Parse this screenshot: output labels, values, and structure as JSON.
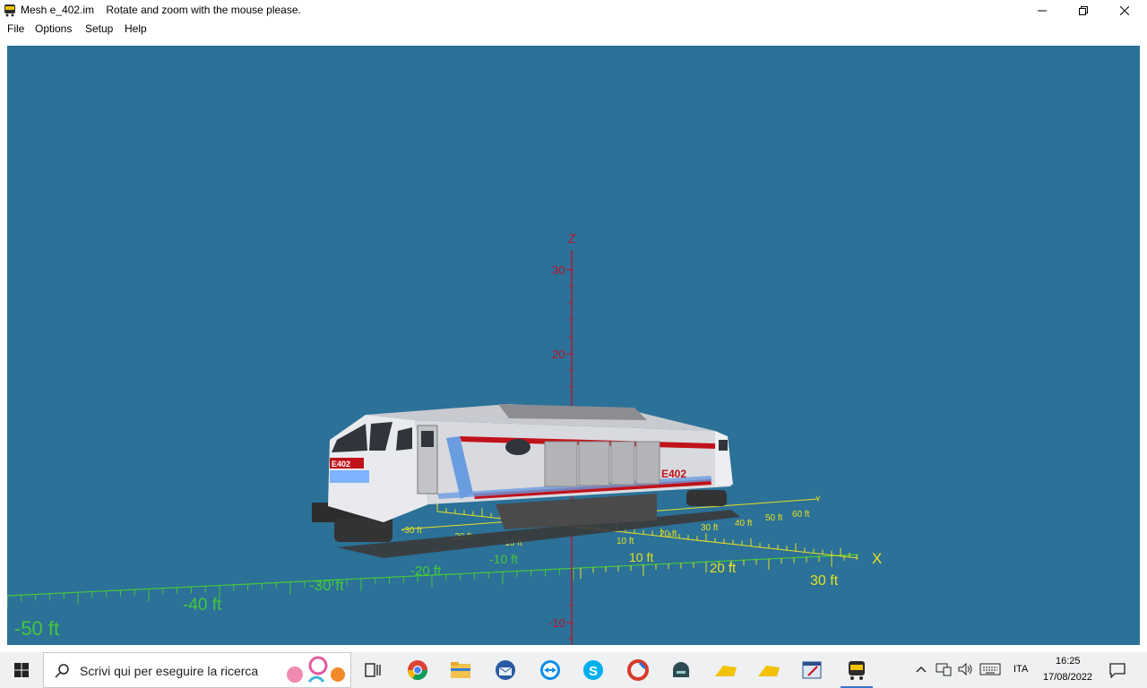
{
  "window": {
    "title": "Mesh e_402.im    Rotate and zoom with the mouse please."
  },
  "menu": {
    "items": [
      "File",
      "Options",
      "Setup",
      "Help"
    ]
  },
  "viewport": {
    "background": "#2b7198",
    "z_axis": {
      "label": "Z",
      "ticks": [
        "30",
        "20",
        "-10"
      ],
      "color": "#c0102a"
    },
    "x_axis": {
      "label": "X",
      "ticks": [
        "-50 ft",
        "-40 ft",
        "-30 ft",
        "-20 ft",
        "-10 ft",
        "10 ft",
        "20 ft",
        "30 ft"
      ],
      "color": "#e8e020"
    },
    "y_axis": {
      "label": "Y",
      "ticks": [
        "-30 ft",
        "-20 ft",
        "-10 ft",
        "10 ft",
        "20 ft",
        "30 ft",
        "40 ft",
        "50 ft",
        "60 ft"
      ]
    },
    "model": {
      "name": "E402",
      "livery": "white-blue-red"
    }
  },
  "taskbar": {
    "search_placeholder": "Scrivi qui per eseguire la ricerca",
    "apps": [
      "task-view",
      "chrome",
      "file-explorer",
      "thunderbird",
      "teamviewer",
      "skype",
      "ccleaner",
      "app-dark",
      "yellow-app-1",
      "yellow-app-2",
      "mail-app",
      "mesh-viewer"
    ],
    "language": "ITA",
    "time": "16:25",
    "date": "17/08/2022"
  }
}
